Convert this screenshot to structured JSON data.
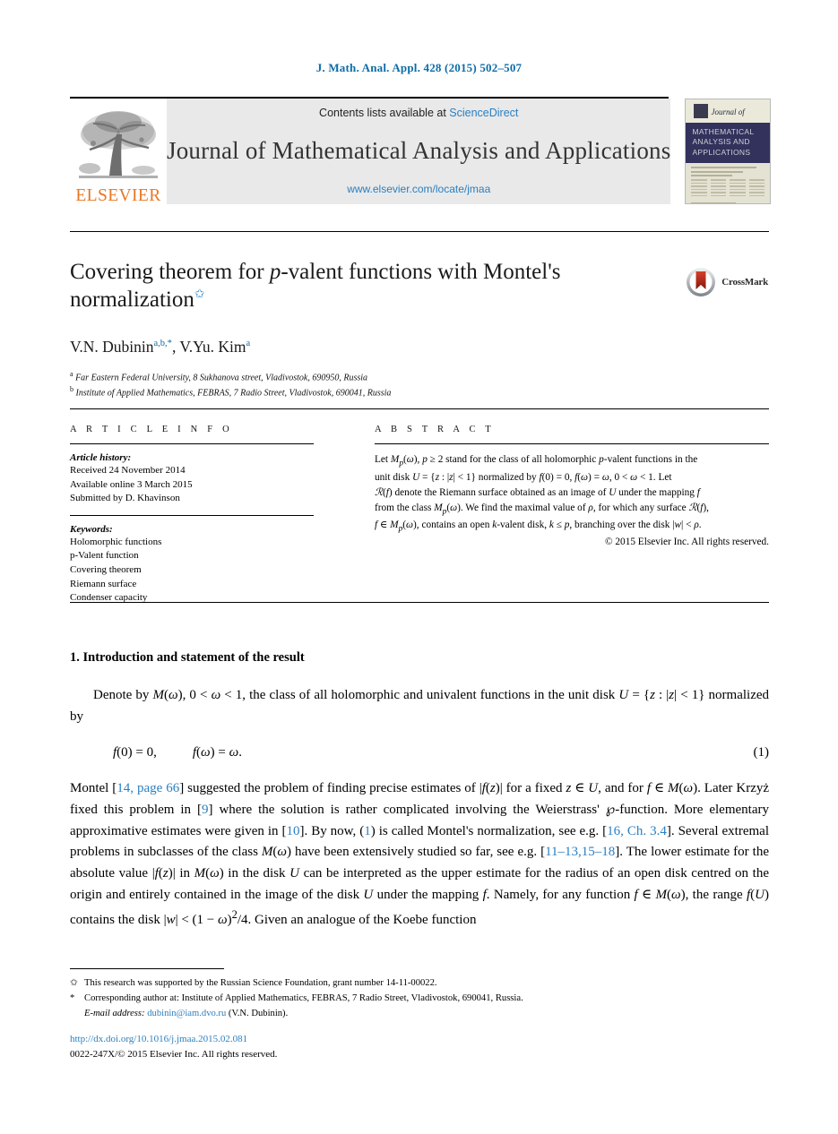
{
  "running_head": "J. Math. Anal. Appl. 428 (2015) 502–507",
  "masthead": {
    "contents_prefix": "Contents lists available at ",
    "sciencedirect": "ScienceDirect",
    "journal_title": "Journal of Mathematical Analysis and Applications",
    "journal_url": "www.elsevier.com/locate/jmaa",
    "publisher_word": "ELSEVIER",
    "cover": {
      "script_word": "Journal of",
      "band_line1": "MATHEMATICAL",
      "band_line2": "ANALYSIS AND",
      "band_line3": "APPLICATIONS"
    }
  },
  "article": {
    "title_part1": "Covering theorem for ",
    "title_italic": "p",
    "title_part2": "-valent functions with Montel's",
    "title_line2": "normalization",
    "title_star": "✩",
    "authors_html": "V.N. Dubinin, V.Yu. Kim",
    "author1_name": "V.N. Dubinin",
    "author1_sup": "a,b,*",
    "author2_name": "V.Yu. Kim",
    "author2_sup": "a",
    "affiliation_a_mark": "a",
    "affiliation_a": "Far Eastern Federal University, 8 Sukhanova street, Vladivostok, 690950, Russia",
    "affiliation_b_mark": "b",
    "affiliation_b": "Institute of Applied Mathematics, FEBRAS, 7 Radio Street, Vladivostok, 690041, Russia"
  },
  "crossmark": {
    "label": "CrossMark"
  },
  "info": {
    "heading": "A R T I C L E   I N F O",
    "history_label": "Article history:",
    "history": [
      "Received 24 November 2014",
      "Available online 3 March 2015",
      "Submitted by D. Khavinson"
    ],
    "keywords_label": "Keywords:",
    "keywords": [
      "Holomorphic functions",
      "p-Valent function",
      "Covering theorem",
      "Riemann surface",
      "Condenser capacity"
    ]
  },
  "abstract": {
    "heading": "A B S T R A C T",
    "lines": [
      "Let  M_p(ω),  p ≥ 2  stand for the class of all holomorphic p-valent functions  in  the",
      "unit disk  U = {z : |z| < 1}  normalized by  f(0) = 0, f(ω) = ω, 0 < ω < 1. Let",
      "R(f) denote the Riemann surface obtained as an image of U under the mapping f",
      "from the class M_p(ω). We find the maximal value of ρ, for which any surface R(f),",
      "f ∈ M_p(ω), contains an open k-valent disk, k ≤ p, branching over the disk |w| < ρ."
    ],
    "copyright": "© 2015 Elsevier Inc. All rights reserved."
  },
  "section": {
    "heading": "1.  Introduction and statement of the result",
    "para1_a": "Denote by ",
    "para1_b": "M(ω), 0 < ω < 1",
    "para1_c": ", the class of all holomorphic and univalent functions in the unit disk ",
    "para1_d": "U = {z : |z| < 1}",
    "para1_e": " normalized by",
    "equation1_lhs": "f(0) = 0,",
    "equation1_rhs": "f(ω) = ω.",
    "equation1_num": "(1)",
    "para2": "Montel [14, page 66] suggested the problem of finding precise estimates of |f(z)| for a fixed z ∈ U, and for f ∈ M(ω). Later Krzyż fixed this problem in [9] where the solution is rather complicated involving the Weierstrass' ℘-function. More elementary approximative estimates were given in [10]. By now, (1) is called Montel's normalization, see e.g. [16, Ch. 3.4]. Several extremal problems in subclasses of the class M(ω) have been extensively studied so far, see e.g. [11–13,15–18]. The lower estimate for the absolute value |f(z)| in M(ω) in the disk U can be interpreted as the upper estimate for the radius of an open disk centred on the origin and entirely contained in the image of the disk U under the mapping f. Namely, for any function f ∈ M(ω), the range f(U) contains the disk |w| < (1 − ω)²/4. Given an analogue of the Koebe function",
    "refs": {
      "r14": "14, page 66",
      "r9": "9",
      "r10": "10",
      "r1": "1",
      "r16": "16, Ch. 3.4",
      "r11": "11–13,15–18"
    }
  },
  "footnotes": {
    "star_mark": "✩",
    "star_text": "This research was supported by the Russian Science Foundation, grant number 14-11-00022.",
    "asterisk_mark": "*",
    "asterisk_text": "Corresponding author at: Institute of Applied Mathematics, FEBRAS, 7 Radio Street, Vladivostok, 690041, Russia.",
    "email_label": "E-mail address:",
    "email": "dubinin@iam.dvo.ru",
    "email_owner": "(V.N. Dubinin)."
  },
  "footer": {
    "doi": "http://dx.doi.org/10.1016/j.jmaa.2015.02.081",
    "issn_line": "0022-247X/© 2015 Elsevier Inc. All rights reserved."
  },
  "colors": {
    "link_blue": "#2a7fc1",
    "head_blue": "#0d6ca8",
    "elsevier_orange": "#E87722",
    "masthead_grey": "#e9e9e9",
    "cover_navy": "#32325c"
  }
}
